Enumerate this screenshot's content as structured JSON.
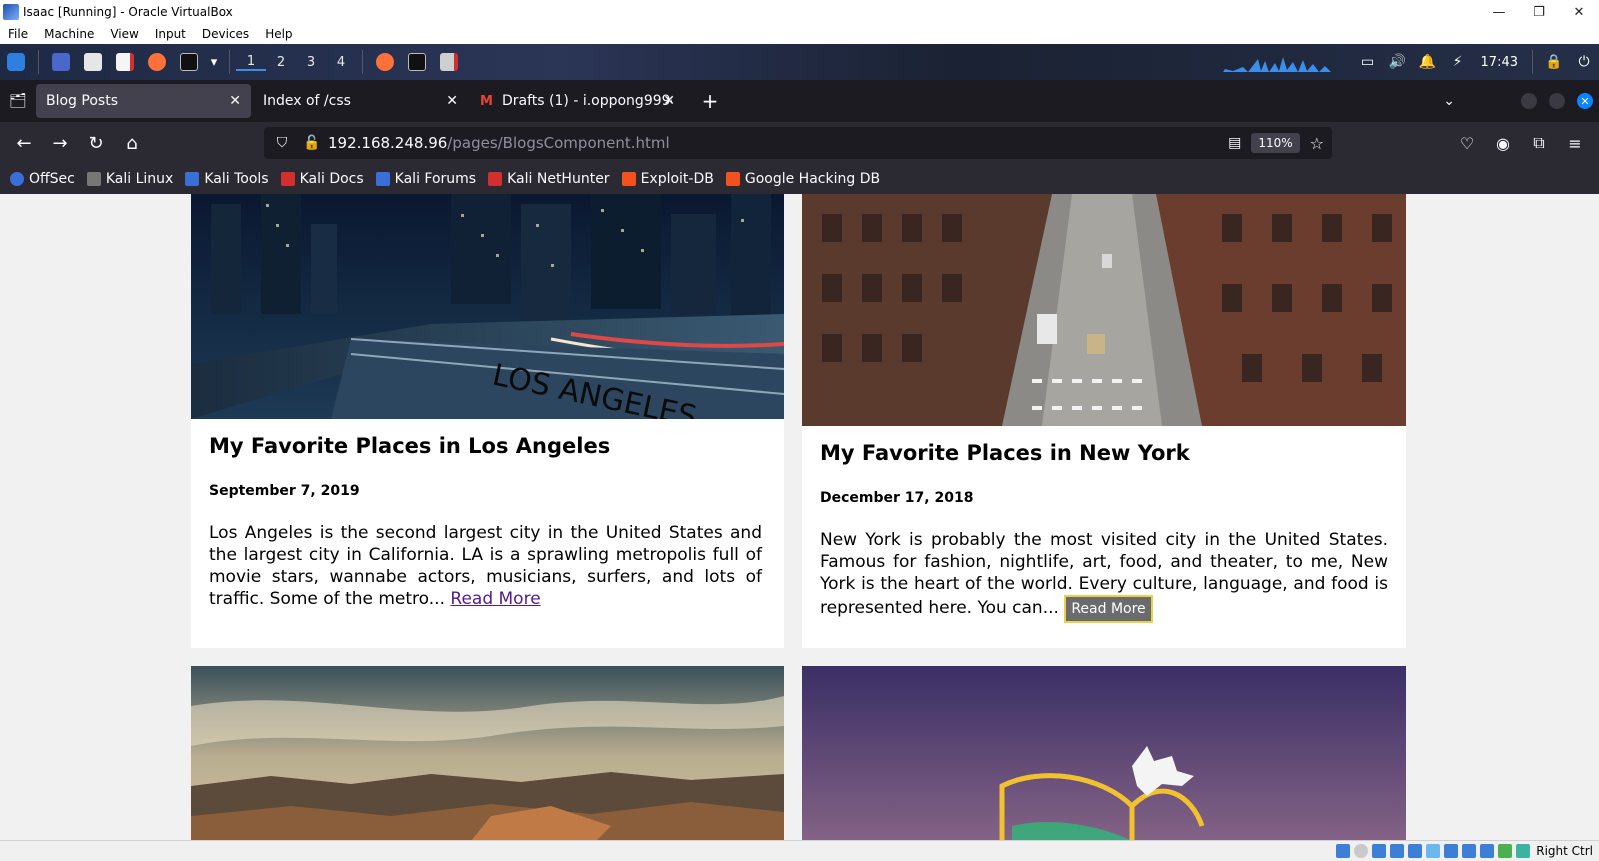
{
  "vbox": {
    "window_title": "Isaac [Running] - Oracle VirtualBox",
    "menu": [
      "File",
      "Machine",
      "View",
      "Input",
      "Devices",
      "Help"
    ],
    "host_key": "Right Ctrl"
  },
  "kali_panel": {
    "workspaces": [
      "1",
      "2",
      "3",
      "4"
    ],
    "active_workspace": "1",
    "clock": "17:43"
  },
  "browser": {
    "tabs": [
      {
        "title": "Blog Posts",
        "active": true
      },
      {
        "title": "Index of /css",
        "active": false
      },
      {
        "title": "Drafts (1) - i.oppong999@",
        "active": false,
        "favicon": "M"
      }
    ],
    "url_host": "192.168.248.96",
    "url_path": "/pages/BlogsComponent.html",
    "zoom": "110%",
    "bookmarks": [
      {
        "label": "OffSec",
        "color": "#3b6fd8"
      },
      {
        "label": "Kali Linux",
        "color": "#555555"
      },
      {
        "label": "Kali Tools",
        "color": "#3b6fd8"
      },
      {
        "label": "Kali Docs",
        "color": "#d32f2f"
      },
      {
        "label": "Kali Forums",
        "color": "#3b6fd8"
      },
      {
        "label": "Kali NetHunter",
        "color": "#d32f2f"
      },
      {
        "label": "Exploit-DB",
        "color": "#f4511e"
      },
      {
        "label": "Google Hacking DB",
        "color": "#f4511e"
      }
    ]
  },
  "posts": [
    {
      "title": "My Favorite Places in Los Angeles",
      "date": "September 7, 2019",
      "excerpt": "Los Angeles is the second largest city in the United States and the largest city in California. LA is a sprawling metropolis full of movie stars, wannabe actors, musicians, surfers, and lots of traffic. Some of the metro...",
      "read_more": "Read More",
      "image": "los-angeles-freeway-night"
    },
    {
      "title": "My Favorite Places in New York",
      "date": "December 17, 2018",
      "excerpt": "New York is probably the most visited city in the United States. Famous for fashion, nightlife, art, food, and theater, to me, New York is the heart of the world. Every culture, language, and food is represented here. You can...",
      "read_more": "Read More",
      "image": "new-york-street-aerial"
    },
    {
      "image": "grand-canyon"
    },
    {
      "image": "neon-sign-dusk"
    }
  ]
}
